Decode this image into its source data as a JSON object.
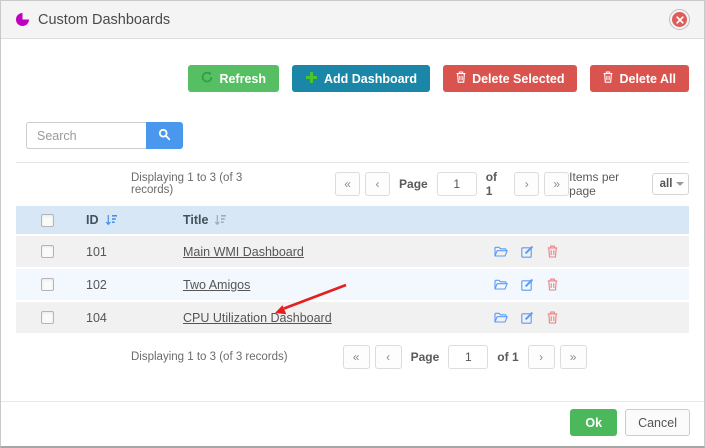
{
  "modal": {
    "title": "Custom Dashboards"
  },
  "toolbar": {
    "refresh_label": "Refresh",
    "add_label": "Add Dashboard",
    "delete_selected_label": "Delete Selected",
    "delete_all_label": "Delete All"
  },
  "search": {
    "placeholder": "Search"
  },
  "pagination": {
    "summary": "Displaying 1 to 3 (of 3 records)",
    "first_label": "«",
    "prev_label": "‹",
    "page_label": "Page",
    "page_value": "1",
    "of_label": "of 1",
    "next_label": "›",
    "last_label": "»",
    "items_per_page_label": "Items per page",
    "items_per_page_value": "all"
  },
  "table": {
    "columns": {
      "id": "ID",
      "title": "Title"
    },
    "rows": [
      {
        "id": "101",
        "title": "Main WMI Dashboard"
      },
      {
        "id": "102",
        "title": "Two Amigos"
      },
      {
        "id": "104",
        "title": "CPU Utilization Dashboard"
      }
    ]
  },
  "footer": {
    "ok_label": "Ok",
    "cancel_label": "Cancel"
  },
  "annotation": {
    "type": "arrow",
    "color": "#e41f1f",
    "target_row_title": "CPU Utilization Dashboard"
  },
  "colors": {
    "accent_magenta": "#bf00bf",
    "refresh_green": "#57bf63",
    "add_teal": "#1b87a8",
    "danger_red": "#d9534f",
    "link_blue": "#4a90e2",
    "ok_green": "#4cb85c",
    "table_header_bg": "#d7e7f5"
  }
}
